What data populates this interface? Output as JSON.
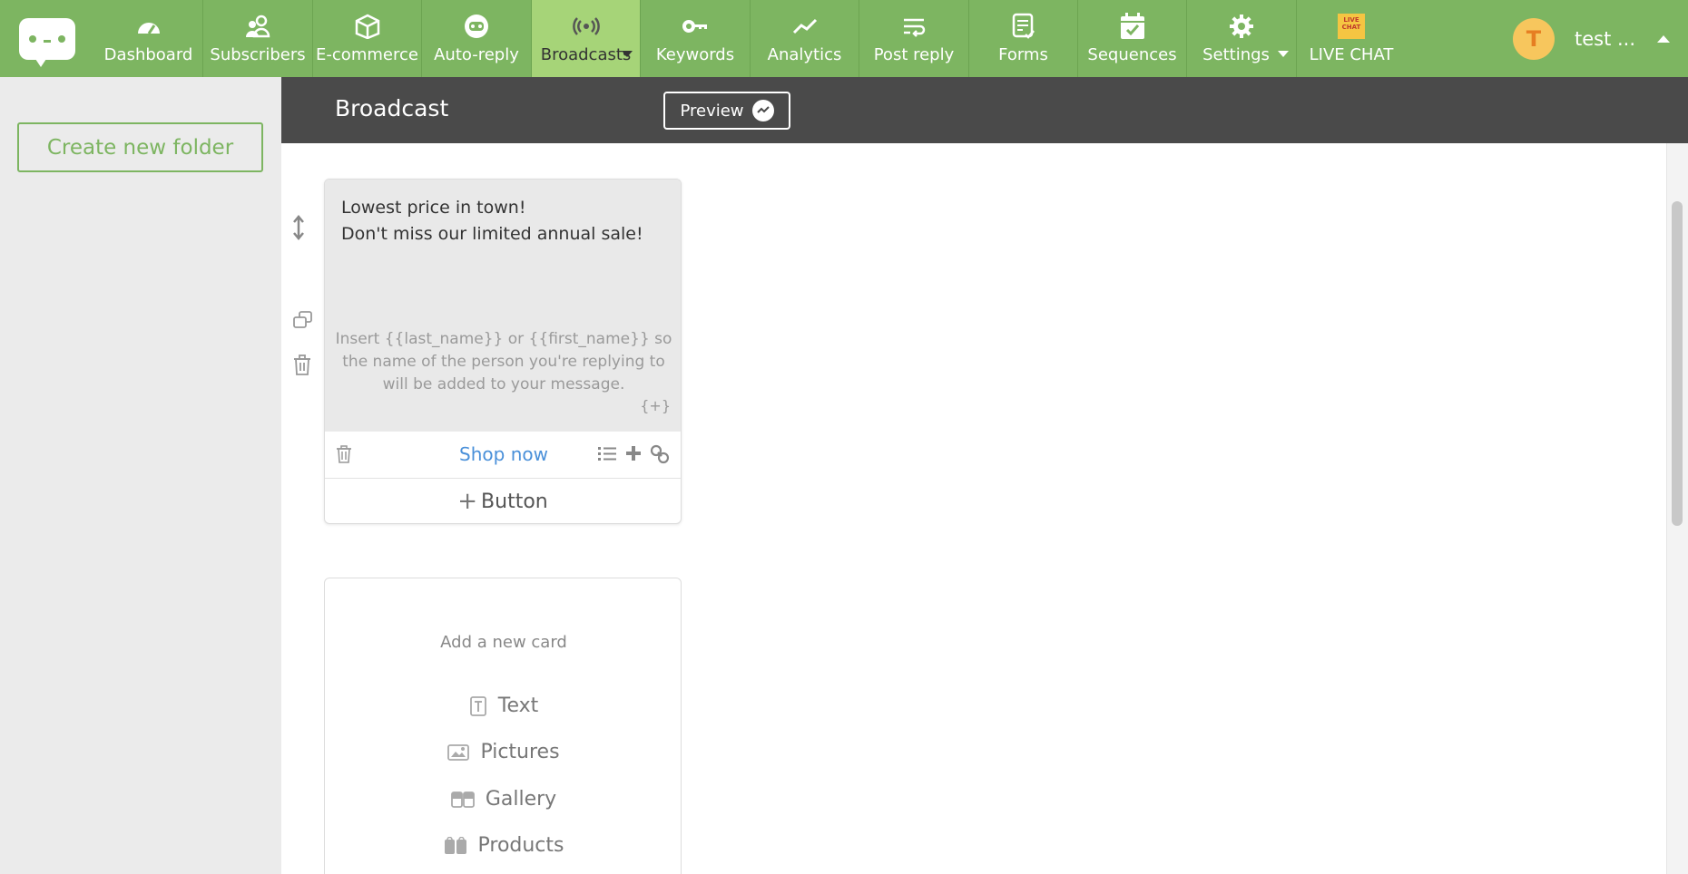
{
  "nav": {
    "items": [
      {
        "label": "Dashboard",
        "icon": "dashboard-icon"
      },
      {
        "label": "Subscribers",
        "icon": "subscribers-icon"
      },
      {
        "label": "E-commerce",
        "icon": "ecommerce-icon"
      },
      {
        "label": "Auto-reply",
        "icon": "auto-reply-icon"
      },
      {
        "label": "Broadcasts",
        "icon": "broadcast-icon"
      },
      {
        "label": "Keywords",
        "icon": "key-icon"
      },
      {
        "label": "Analytics",
        "icon": "analytics-icon"
      },
      {
        "label": "Post reply",
        "icon": "post-reply-icon"
      },
      {
        "label": "Forms",
        "icon": "forms-icon"
      },
      {
        "label": "Sequences",
        "icon": "calendar-check-icon"
      },
      {
        "label": "Settings",
        "icon": "gear-icon"
      },
      {
        "label": "LIVE CHAT",
        "icon": "live-chat-icon"
      }
    ],
    "active": "Broadcasts",
    "livechat_badge": "LIVE CHAT"
  },
  "user": {
    "initial": "T",
    "name": "test ..."
  },
  "sidebar": {
    "create_folder_label": "Create new folder"
  },
  "header": {
    "title": "Broadcast",
    "preview_label": "Preview"
  },
  "card": {
    "text_line1": "Lowest price in town!",
    "text_line2": "Don't miss our limited annual sale!",
    "hint": "Insert {{last_name}} or {{first_name}} so the name of the person you're replying to will be added to your message.",
    "insert_token": "{+}",
    "button_label": "Shop now",
    "add_button_label": "Button"
  },
  "new_card": {
    "heading": "Add a new card",
    "options": [
      "Text",
      "Pictures",
      "Gallery",
      "Products"
    ]
  },
  "colors": {
    "brand_green": "#7db561",
    "active_tab": "#a6d478",
    "header_dark": "#4a4a4a",
    "link_blue": "#4a90d9",
    "avatar": "#f7c65d"
  }
}
